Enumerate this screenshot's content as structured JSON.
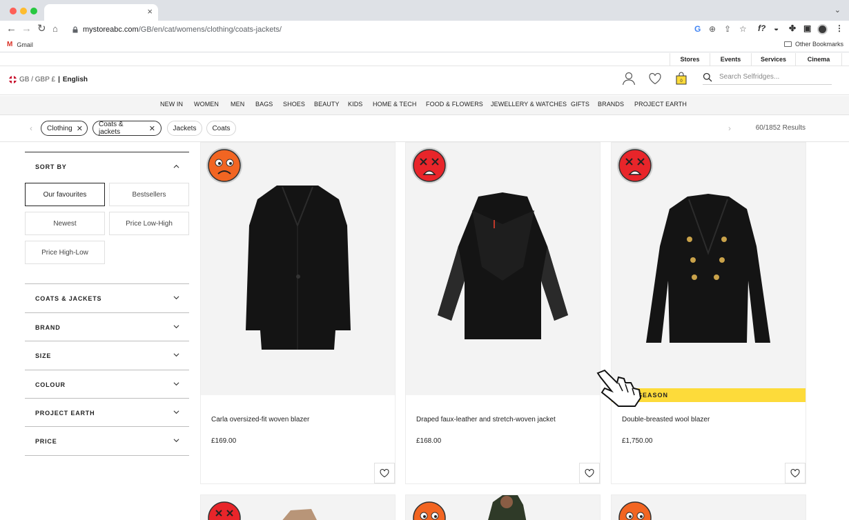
{
  "browser": {
    "tab_close": "×",
    "url_host": "mystoreabc.com",
    "url_path": "/GB/en/cat/womens/clothing/coats-jackets/",
    "bookmarks": {
      "gmail": "Gmail",
      "other": "Other Bookmarks"
    }
  },
  "utility": {
    "links": [
      "Stores",
      "Events",
      "Services",
      "Cinema"
    ]
  },
  "header": {
    "locale": "GB / GBP £",
    "separator": "|",
    "language": "English",
    "search_placeholder": "Search Selfridges..."
  },
  "catnav": [
    "NEW IN",
    "WOMEN",
    "MEN",
    "BAGS",
    "SHOES",
    "BEAUTY",
    "KIDS",
    "HOME & TECH",
    "FOOD & FLOWERS",
    "JEWELLERY & WATCHES",
    "GIFTS",
    "BRANDS",
    "PROJECT EARTH"
  ],
  "filters": {
    "active_chips": [
      "Clothing",
      "Coats & jackets"
    ],
    "suggested_chips": [
      "Jackets",
      "Coats"
    ],
    "results": "60/1852 Results"
  },
  "sidebar": {
    "sort_label": "SORT BY",
    "sort_options": [
      "Our favourites",
      "Bestsellers",
      "Newest",
      "Price Low-High",
      "Price High-Low"
    ],
    "sections": [
      "COATS & JACKETS",
      "BRAND",
      "SIZE",
      "COLOUR",
      "PROJECT EARTH",
      "PRICE"
    ]
  },
  "products": [
    {
      "name": "Carla oversized-fit woven blazer",
      "price": "£169.00",
      "emoji": "sad-face",
      "emoji_color": "#f26522"
    },
    {
      "name": "Draped faux-leather and stretch-woven jacket",
      "price": "£168.00",
      "emoji": "dead-face",
      "emoji_color": "#e8252a"
    },
    {
      "name": "Double-breasted wool blazer",
      "price": "£1,750.00",
      "emoji": "dead-face",
      "emoji_color": "#e8252a",
      "badge": "SEASON"
    }
  ],
  "colors": {
    "badge": "#fddb3a",
    "accent": "#222222"
  }
}
